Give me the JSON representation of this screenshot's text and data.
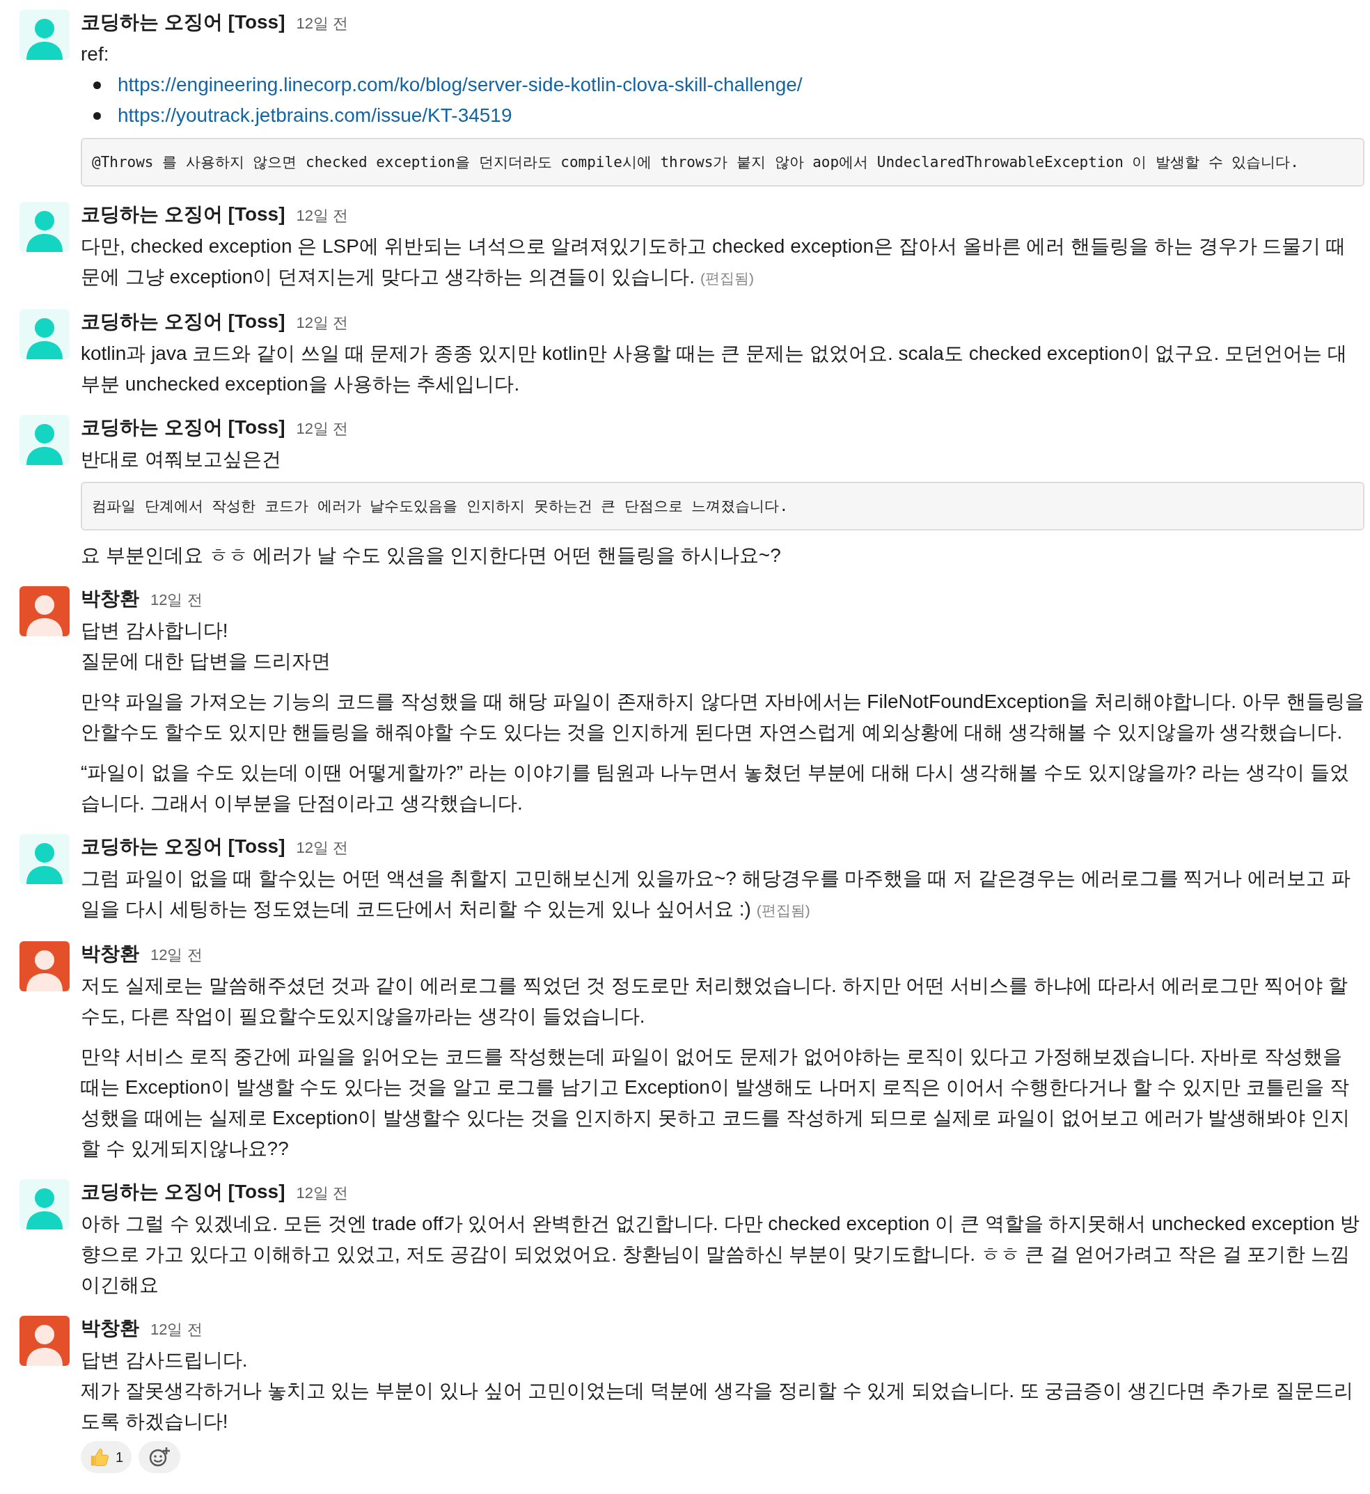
{
  "messages": [
    {
      "author": "코딩하는 오징어 [Toss]",
      "time": "12일 전",
      "avatar": {
        "kind": "tint",
        "color": "#14d4c2"
      },
      "blocks": [
        {
          "kind": "lines",
          "lines": [
            "ref:"
          ]
        },
        {
          "kind": "links",
          "links": [
            "https://engineering.linecorp.com/ko/blog/server-side-kotlin-clova-skill-challenge/",
            "https://youtrack.jetbrains.com/issue/KT-34519"
          ]
        },
        {
          "kind": "code",
          "text": "@Throws 를 사용하지 않으면 checked exception을 던지더라도 compile시에 throws가 붙지 않아 aop에서 UndeclaredThrowableException 이 발생할 수 있습니다."
        }
      ]
    },
    {
      "author": "코딩하는 오징어 [Toss]",
      "time": "12일 전",
      "avatar": {
        "kind": "tint",
        "color": "#14d4c2"
      },
      "blocks": [
        {
          "kind": "paragraph",
          "text": "다만, checked exception 은 LSP에 위반되는 녀석으로 알려져있기도하고 checked exception은 잡아서 올바른 에러 핸들링을 하는 경우가 드물기 때문에 그냥 exception이 던져지는게 맞다고 생각하는 의견들이 있습니다.",
          "edited": "(편집됨)"
        }
      ]
    },
    {
      "author": "코딩하는 오징어 [Toss]",
      "time": "12일 전",
      "avatar": {
        "kind": "tint",
        "color": "#14d4c2"
      },
      "blocks": [
        {
          "kind": "paragraph",
          "text": "kotlin과 java 코드와 같이 쓰일 때 문제가 종종 있지만 kotlin만 사용할 때는 큰 문제는 없었어요. scala도 checked exception이 없구요. 모던언어는 대부분 unchecked exception을 사용하는 추세입니다."
        }
      ]
    },
    {
      "author": "코딩하는 오징어 [Toss]",
      "time": "12일 전",
      "avatar": {
        "kind": "tint",
        "color": "#14d4c2"
      },
      "blocks": [
        {
          "kind": "lines",
          "lines": [
            "반대로 여쭤보고싶은건"
          ]
        },
        {
          "kind": "code",
          "text": "컴파일 단계에서 작성한 코드가 에러가 날수도있음을 인지하지 못하는건 큰 단점으로 느껴졌습니다."
        },
        {
          "kind": "paragraph",
          "text": "요 부분인데요 ㅎㅎ 에러가 날 수도 있음을 인지한다면 어떤 핸들링을 하시나요~?"
        }
      ]
    },
    {
      "author": "박창환",
      "time": "12일 전",
      "avatar": {
        "kind": "solid",
        "color": "#e4502a"
      },
      "blocks": [
        {
          "kind": "lines",
          "lines": [
            "답변 감사합니다!",
            "질문에 대한 답변을 드리자면"
          ]
        },
        {
          "kind": "paragraph",
          "text": "만약 파일을 가져오는 기능의 코드를 작성했을 때 해당 파일이 존재하지 않다면 자바에서는 FileNotFoundException을 처리해야합니다. 아무 핸들링을 안할수도 할수도 있지만 핸들링을 해줘야할 수도 있다는 것을 인지하게 된다면 자연스럽게 예외상황에 대해 생각해볼 수 있지않을까 생각했습니다."
        },
        {
          "kind": "paragraph",
          "text": "“파일이 없을 수도 있는데 이땐 어떻게할까?” 라는 이야기를 팀원과 나누면서 놓쳤던 부분에 대해 다시 생각해볼 수도 있지않을까? 라는 생각이 들었습니다. 그래서 이부분을 단점이라고 생각했습니다."
        }
      ]
    },
    {
      "author": "코딩하는 오징어 [Toss]",
      "time": "12일 전",
      "avatar": {
        "kind": "tint",
        "color": "#14d4c2"
      },
      "blocks": [
        {
          "kind": "paragraph",
          "text": "그럼 파일이 없을 때 할수있는 어떤 액션을 취할지 고민해보신게 있을까요~? 해당경우를 마주했을 때 저 같은경우는 에러로그를 찍거나 에러보고 파일을 다시 세팅하는 정도였는데 코드단에서 처리할 수 있는게 있나 싶어서요 :)",
          "edited": "(편집됨)"
        }
      ]
    },
    {
      "author": "박창환",
      "time": "12일 전",
      "avatar": {
        "kind": "solid",
        "color": "#e4502a"
      },
      "blocks": [
        {
          "kind": "paragraph",
          "text": "저도 실제로는 말씀해주셨던 것과 같이 에러로그를 찍었던 것 정도로만 처리했었습니다. 하지만 어떤 서비스를 하냐에 따라서 에러로그만 찍어야 할수도, 다른 작업이 필요할수도있지않을까라는 생각이 들었습니다."
        },
        {
          "kind": "paragraph",
          "text": "만약 서비스 로직 중간에 파일을 읽어오는 코드를 작성했는데 파일이 없어도 문제가 없어야하는 로직이 있다고 가정해보겠습니다. 자바로 작성했을 때는 Exception이 발생할 수도 있다는 것을 알고 로그를 남기고 Exception이 발생해도 나머지 로직은 이어서  수행한다거나 할 수 있지만 코틀린을 작성했을 때에는 실제로 Exception이 발생할수 있다는 것을 인지하지 못하고 코드를 작성하게 되므로 실제로 파일이 없어보고 에러가 발생해봐야 인지할 수 있게되지않나요??"
        }
      ]
    },
    {
      "author": "코딩하는 오징어 [Toss]",
      "time": "12일 전",
      "avatar": {
        "kind": "tint",
        "color": "#14d4c2"
      },
      "blocks": [
        {
          "kind": "paragraph",
          "text": "아하 그럴 수 있겠네요. 모든 것엔 trade off가 있어서 완벽한건 없긴합니다. 다만 checked exception 이 큰 역할을 하지못해서 unchecked exception 방향으로 가고 있다고 이해하고 있었고, 저도 공감이 되었었어요. 창환님이 말씀하신 부분이 맞기도합니다. ㅎㅎ 큰 걸 얻어가려고 작은 걸 포기한 느낌이긴해요"
        }
      ]
    },
    {
      "author": "박창환",
      "time": "12일 전",
      "avatar": {
        "kind": "solid",
        "color": "#e4502a"
      },
      "blocks": [
        {
          "kind": "lines",
          "lines": [
            "답변 감사드립니다.",
            "제가 잘못생각하거나 놓치고 있는 부분이 있나 싶어 고민이었는데 덕분에 생각을 정리할 수 있게 되었습니다. 또 궁금증이 생긴다면 추가로 질문드리도록 하겠습니다!"
          ]
        },
        {
          "kind": "reactions",
          "reactions": [
            {
              "count": "1"
            }
          ]
        }
      ]
    }
  ]
}
